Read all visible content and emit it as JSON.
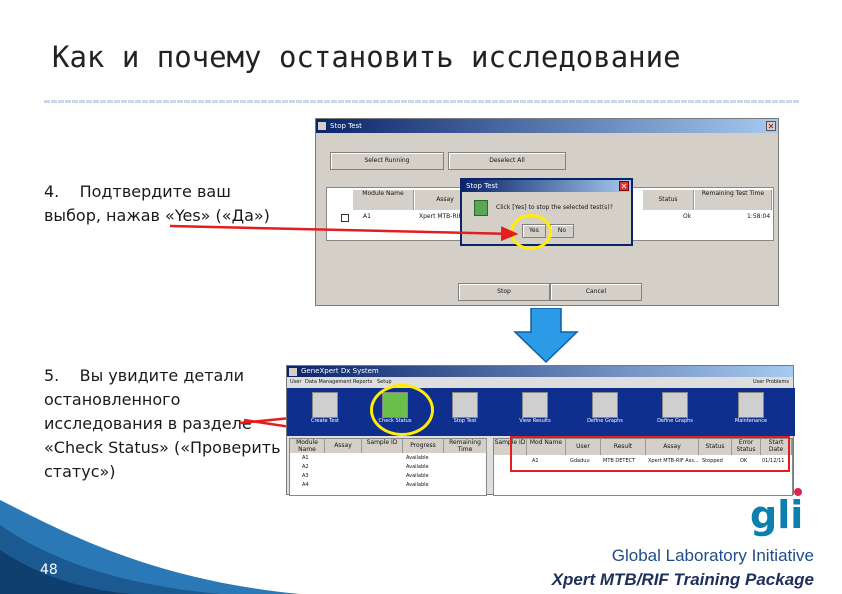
{
  "slide": {
    "title": "Как и почему остановить исследование",
    "step4": {
      "number": "4.",
      "text": "Подтвердите ваш выбор, нажав «Yes» («Да»)"
    },
    "step5": {
      "number": "5.",
      "text": "Вы увидите детали остановленного исследования в разделе «Check Status» («Проверить статус»)"
    },
    "page_number": "48",
    "footer_org": "Global Laboratory Initiative",
    "footer_package": "Xpert MTB/RIF Training Package",
    "logo_text": "gli"
  },
  "stop_test_window": {
    "title": "Stop Test",
    "select_running": "Select Running",
    "deselect_all": "Deselect All",
    "columns": [
      "Module Name",
      "Assay",
      "Status",
      "Remaining Test Time"
    ],
    "row": {
      "module": "A1",
      "assay": "Xpert MTB-RIF",
      "status": "Ok",
      "time": "1:58:04"
    },
    "stop": "Stop",
    "cancel": "Cancel"
  },
  "confirm_dialog": {
    "title": "Stop Test",
    "message": "Click [Yes] to stop the selected test(s)?",
    "yes": "Yes",
    "no": "No"
  },
  "gx_window": {
    "title": "GeneXpert Dx System",
    "menus": [
      "User",
      "Data Management",
      "Reports",
      "Setup"
    ],
    "menu_right": "User Problems",
    "toolbar": [
      "Create Test",
      "Check Status",
      "Stop Test",
      "View Results",
      "Define Graphs",
      "Define Graphs",
      "Maintenance"
    ],
    "left_columns": [
      "Module Name",
      "Assay",
      "Sample ID",
      "Progress",
      "Remaining Time"
    ],
    "left_rows": [
      {
        "module": "A1",
        "progress": "Available"
      },
      {
        "module": "A2",
        "progress": "Available"
      },
      {
        "module": "A3",
        "progress": "Available"
      },
      {
        "module": "A4",
        "progress": "Available"
      }
    ],
    "right_columns": [
      "Sample ID",
      "Mod Name",
      "User",
      "Result",
      "Assay",
      "Status",
      "Error Status",
      "Start Date"
    ],
    "right_row": {
      "sample": "",
      "module": "A1",
      "user": "Gdaduu",
      "result": "MTB DETECT",
      "assay": "Xpert MTB-RIF Ass...",
      "status": "Stopped",
      "error": "OK",
      "date": "01/12/11"
    }
  },
  "colors": {
    "arrow": "#e41e1e",
    "highlight": "#ffee00",
    "down_arrow": "#2b9be8",
    "logo": "#0b7fae",
    "toolbar": "#0f2f8f"
  }
}
